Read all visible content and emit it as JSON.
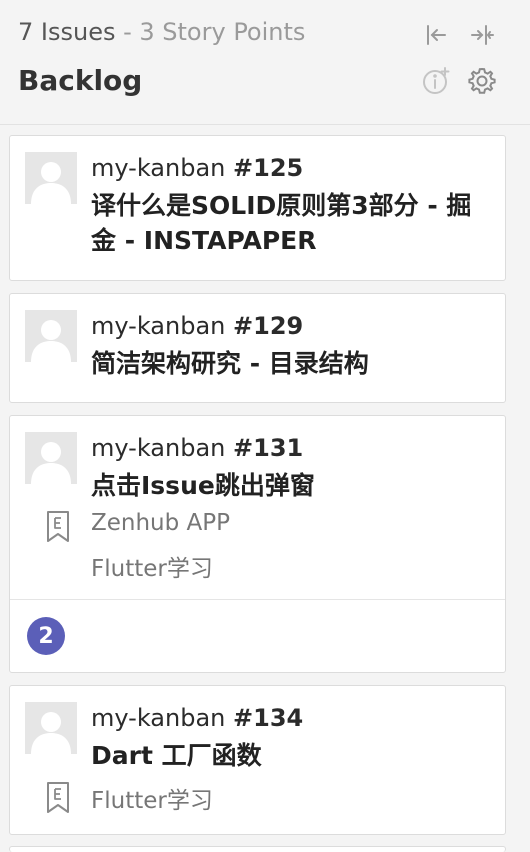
{
  "header": {
    "issues_count": "7 Issues",
    "separator": " - ",
    "story_points": "3 Story Points",
    "pipeline_name": "Backlog",
    "icons": [
      "collapse-left-icon",
      "collapse-pipeline-icon",
      "pipeline-info-icon",
      "settings-icon"
    ]
  },
  "cards": [
    {
      "repo": "my-kanban",
      "number": "#125",
      "title": "译什么是SOLID原则第3部分 - 掘金 - INSTAPAPER"
    },
    {
      "repo": "my-kanban",
      "number": "#129",
      "title": "简洁架构研究 - 目录结构"
    },
    {
      "repo": "my-kanban",
      "number": "#131",
      "title": "点击Issue跳出弹窗",
      "epics": [
        "Zenhub APP",
        "Flutter学习"
      ],
      "estimate": "2"
    },
    {
      "repo": "my-kanban",
      "number": "#134",
      "title": "Dart 工厂函数",
      "epics": [
        "Flutter学习"
      ]
    }
  ]
}
